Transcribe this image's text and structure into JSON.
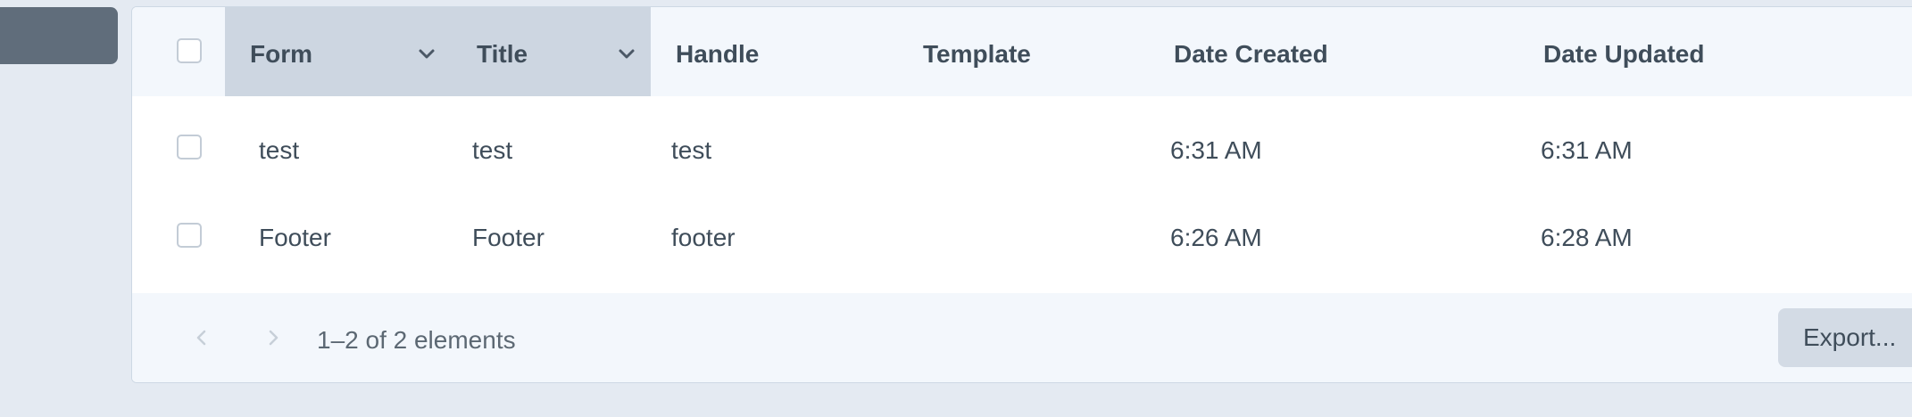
{
  "table": {
    "columns": [
      {
        "label": "Form",
        "sortable": true
      },
      {
        "label": "Title",
        "sortable": true
      },
      {
        "label": "Handle"
      },
      {
        "label": "Template"
      },
      {
        "label": "Date Created"
      },
      {
        "label": "Date Updated"
      }
    ],
    "rows": [
      {
        "form": "test",
        "title": "test",
        "handle": "test",
        "template": "",
        "date_created": "6:31 AM",
        "date_updated": "6:31 AM"
      },
      {
        "form": "Footer",
        "title": "Footer",
        "handle": "footer",
        "template": "",
        "date_created": "6:26 AM",
        "date_updated": "6:28 AM"
      }
    ]
  },
  "footer": {
    "count_text": "1–2 of 2 elements",
    "export_label": "Export..."
  },
  "icons": {
    "sort": "chevron-down-icon",
    "prev": "chevron-left-icon",
    "next": "chevron-right-icon"
  },
  "colors": {
    "header_bg": "#f3f7fc",
    "sorted_header_bg": "#cdd6e1",
    "text": "#3f4d5a",
    "button_bg": "#d3dbe5"
  }
}
